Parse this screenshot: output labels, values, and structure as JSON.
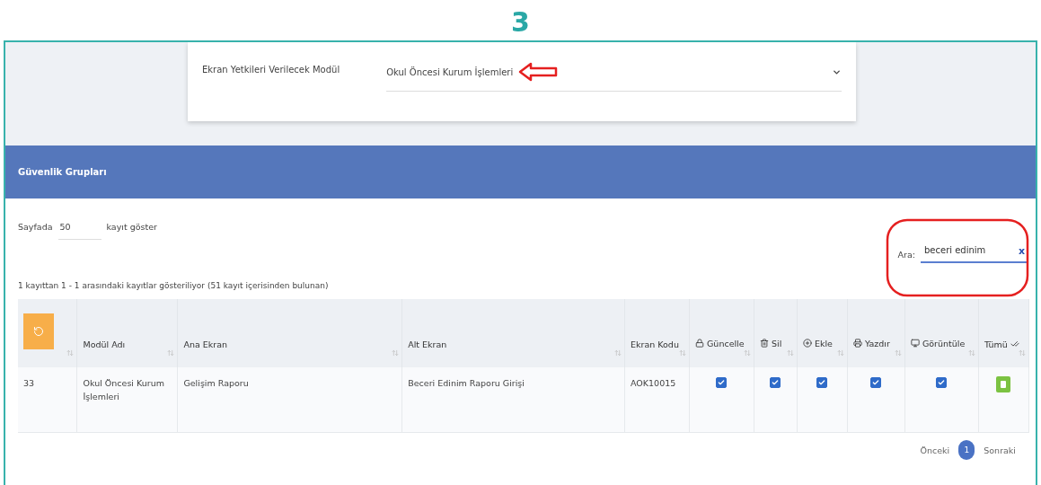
{
  "step": "3",
  "module_select": {
    "label": "Ekran Yetkileri Verilecek Modül",
    "value": "Okul Öncesi Kurum İşlemleri"
  },
  "panel": {
    "title": "Güvenlik Grupları"
  },
  "page_size": {
    "prefix": "Sayfada",
    "value": "50",
    "suffix": "kayıt göster"
  },
  "search": {
    "label": "Ara:",
    "value": "beceri edinim",
    "clear": "x"
  },
  "info": "1 kayıttan 1 - 1 arasındaki kayıtlar gösteriliyor (51 kayıt içerisinden bulunan)",
  "table": {
    "columns": [
      {
        "kind": "refresh"
      },
      {
        "kind": "text",
        "label": "Modül Adı"
      },
      {
        "kind": "text",
        "label": "Ana Ekran"
      },
      {
        "kind": "text",
        "label": "Alt Ekran"
      },
      {
        "kind": "text",
        "label": "Ekran Kodu"
      },
      {
        "kind": "lock",
        "label": "Güncelle"
      },
      {
        "kind": "trash",
        "label": "Sil"
      },
      {
        "kind": "plus",
        "label": "Ekle"
      },
      {
        "kind": "printer",
        "label": "Yazdır"
      },
      {
        "kind": "monitor",
        "label": "Görüntüle"
      },
      {
        "kind": "check",
        "label": "Tümü"
      }
    ],
    "rows": [
      {
        "cells": [
          {
            "kind": "text",
            "value": "33"
          },
          {
            "kind": "text",
            "value": "Okul Öncesi Kurum İşlemleri"
          },
          {
            "kind": "text",
            "value": "Gelişim Raporu"
          },
          {
            "kind": "text",
            "value": "Beceri Edinim Raporu Girişi"
          },
          {
            "kind": "text",
            "value": "AOK10015"
          },
          {
            "kind": "checkbox",
            "checked": true
          },
          {
            "kind": "checkbox",
            "checked": true
          },
          {
            "kind": "checkbox",
            "checked": true
          },
          {
            "kind": "checkbox",
            "checked": true
          },
          {
            "kind": "checkbox",
            "checked": true
          },
          {
            "kind": "toggle",
            "on": true
          }
        ]
      }
    ]
  },
  "pagination": {
    "prev": "Önceki",
    "pages": [
      {
        "label": "1",
        "selected": true
      }
    ],
    "next": "Sonraki"
  }
}
